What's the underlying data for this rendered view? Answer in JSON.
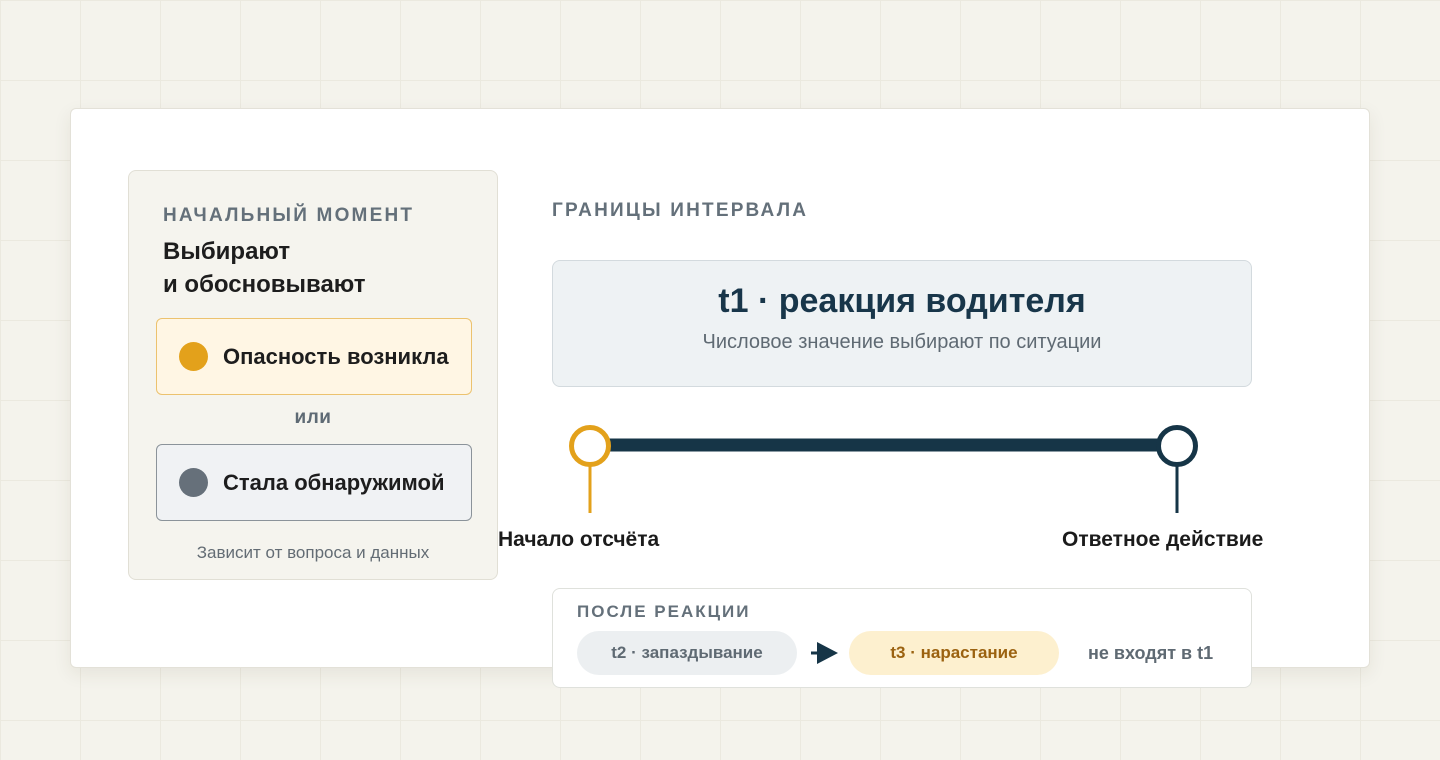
{
  "left_panel": {
    "eyebrow": "НАЧАЛЬНЫЙ МОМЕНТ",
    "title_line1": "Выбирают",
    "title_line2": "и обосновывают",
    "option_a": "Опасность возникла",
    "separator": "или",
    "option_b": "Стала обнаружимой",
    "note": "Зависит от вопроса и данных"
  },
  "main": {
    "eyebrow": "ГРАНИЦЫ ИНТЕРВАЛА",
    "t1_title": "t1 · реакция водителя",
    "t1_subtitle": "Числовое значение выбирают по ситуации"
  },
  "timeline": {
    "start_label": "Начало отсчёта",
    "end_label": "Ответное действие"
  },
  "after": {
    "eyebrow": "ПОСЛЕ РЕАКЦИИ",
    "t2": "t2 · запаздывание",
    "t3": "t3 · нарастание",
    "not_included": "не входят в t1"
  },
  "colors": {
    "accent_amber": "#e3a11b",
    "accent_navy": "#163547",
    "muted_gray": "#66707a"
  },
  "icons": {
    "option_a": "amber-dot-icon",
    "option_b": "gray-dot-icon",
    "start": "start-marker-icon",
    "end": "end-marker-icon",
    "flow": "arrow-right-icon"
  }
}
